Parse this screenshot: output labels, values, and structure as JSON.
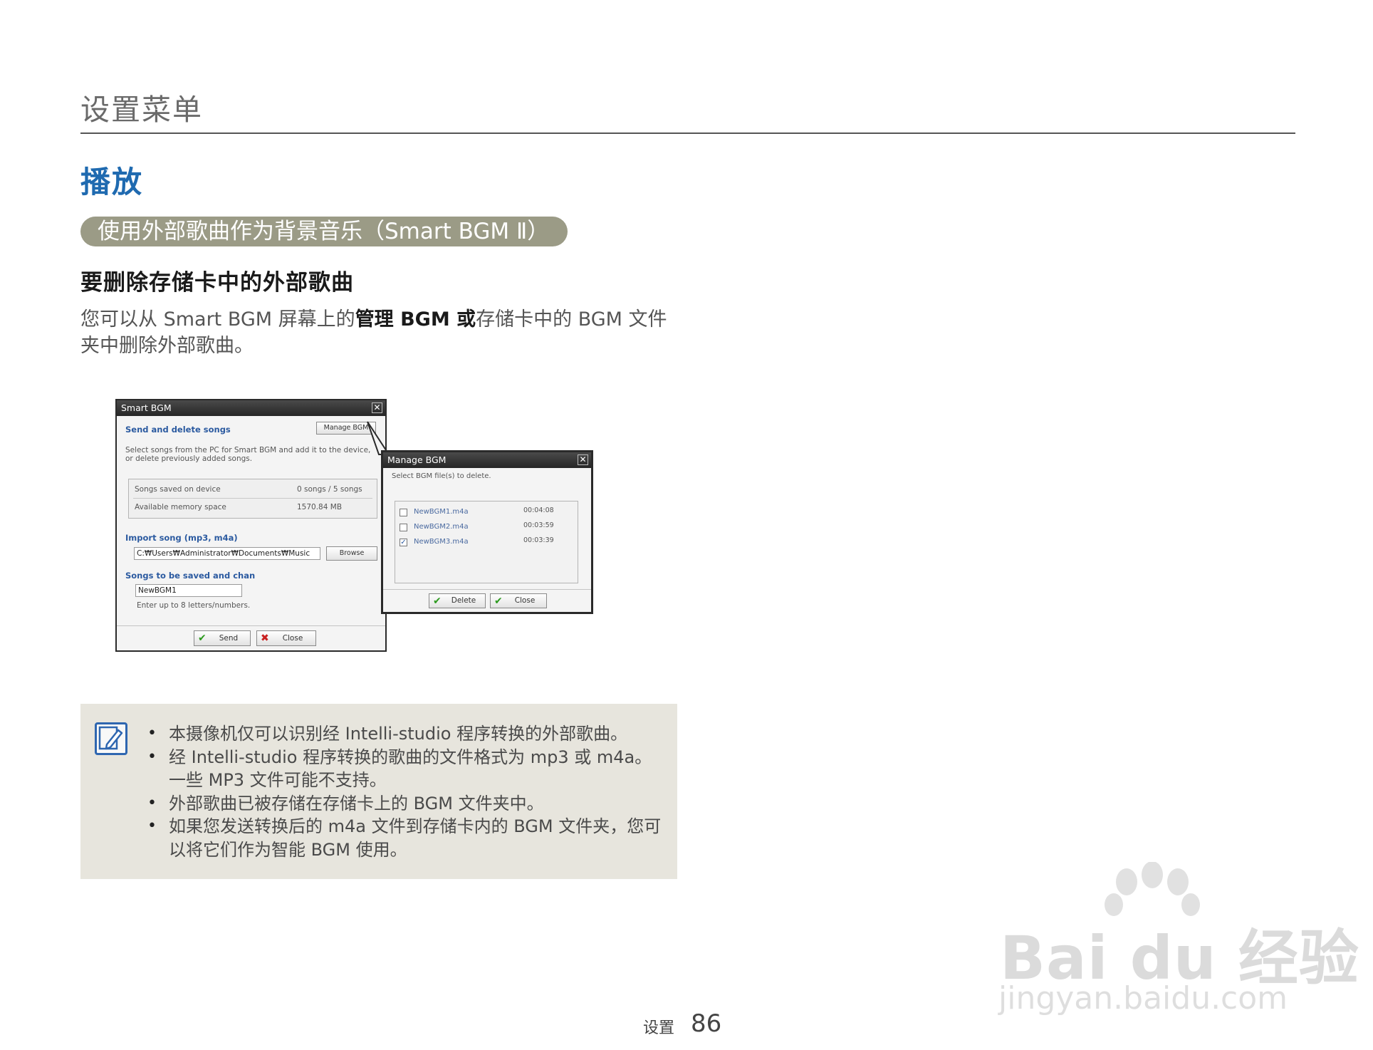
{
  "header": {
    "section_title": "设置菜单"
  },
  "heading": "播放",
  "pill": "使用外部歌曲作为背景音乐（Smart BGM Ⅱ）",
  "subheading": "要删除存储卡中的外部歌曲",
  "paragraph": {
    "part1": "您可以从 Smart BGM  屏幕上的",
    "bold1": "管理 BGM 或",
    "part2": "存储卡中的 BGM 文件夹中删除外部歌曲。"
  },
  "smart_bgm": {
    "title": "Smart BGM",
    "close_x": "✕",
    "section1": "Send and delete songs",
    "manage_button": "Manage BGM",
    "desc": "Select songs from the PC for Smart BGM and add it to the device, or delete previously added songs.",
    "stats": [
      {
        "label": "Songs saved on device",
        "value": "0 songs / 5 songs"
      },
      {
        "label": "Available memory space",
        "value": "1570.84 MB"
      }
    ],
    "import_label": "Import song (mp3, m4a)",
    "import_path": "C:₩Users₩Administrator₩Documents₩Music",
    "browse_button": "Browse",
    "save_label": "Songs to be saved and chan",
    "save_name": "NewBGM1",
    "hint": "Enter up to 8 letters/numbers.",
    "send_button": "Send",
    "close_button": "Close"
  },
  "manage_bgm": {
    "title": "Manage BGM",
    "close_x": "✕",
    "instruction": "Select BGM file(s) to delete.",
    "files": [
      {
        "name": "NewBGM1.m4a",
        "duration": "00:04:08",
        "checked": false
      },
      {
        "name": "NewBGM2.m4a",
        "duration": "00:03:59",
        "checked": false
      },
      {
        "name": "NewBGM3.m4a",
        "duration": "00:03:39",
        "checked": true
      }
    ],
    "delete_button": "Delete",
    "close_button": "Close"
  },
  "notes": [
    "本摄像机仅可以识别经 Intelli-studio 程序转换的外部歌曲。",
    "经 Intelli-studio 程序转换的歌曲的文件格式为 mp3  或  m4a。一些 MP3 文件可能不支持。",
    "外部歌曲已被存储在存储卡上的 BGM 文件夹中。",
    "如果您发送转换后的 m4a 文件到存储卡内的 BGM 文件夹，您可以将它们作为智能 BGM 使用。"
  ],
  "footer": {
    "label": "设置",
    "page_number": "86"
  },
  "watermark": {
    "line1": "Bai du 经验",
    "line2": "jingyan.baidu.com"
  },
  "colors": {
    "heading_blue": "#1f6ab0",
    "pill_bg": "#9b9b86",
    "note_bg": "#e7e5dd",
    "dialog_label_blue": "#2b5aa0"
  }
}
